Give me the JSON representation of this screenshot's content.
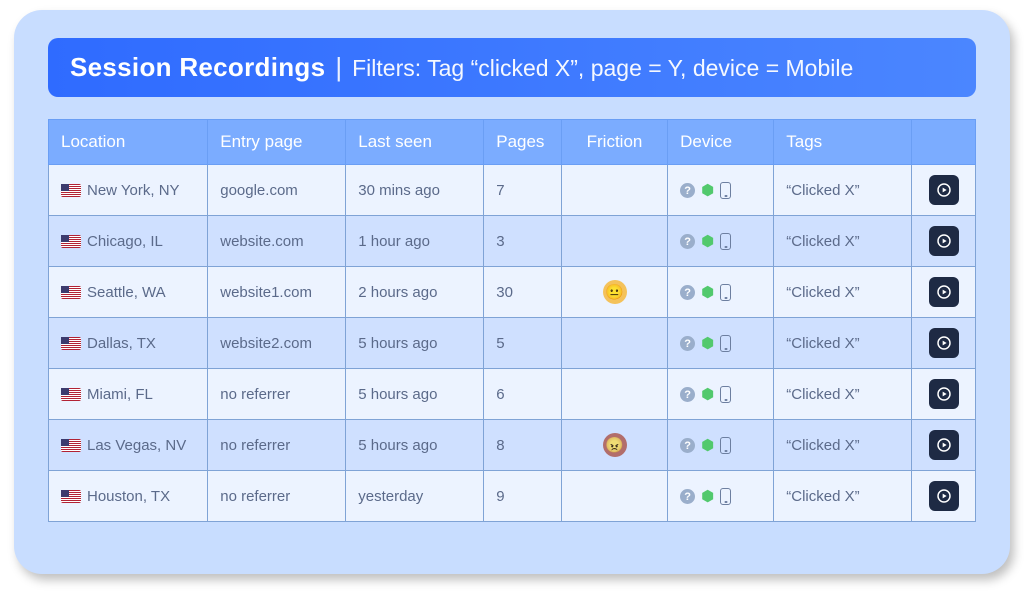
{
  "header": {
    "title": "Session Recordings",
    "separator": "|",
    "filters": "Filters: Tag “clicked X”, page = Y, device = Mobile"
  },
  "columns": {
    "location": "Location",
    "entry_page": "Entry page",
    "last_seen": "Last seen",
    "pages": "Pages",
    "friction": "Friction",
    "device": "Device",
    "tags": "Tags",
    "play": ""
  },
  "rows": [
    {
      "location": "New York, NY",
      "entry": "google.com",
      "last": "30 mins ago",
      "pages": "7",
      "friction": "",
      "tag": "“Clicked X”"
    },
    {
      "location": "Chicago, IL",
      "entry": "website.com",
      "last": "1 hour ago",
      "pages": "3",
      "friction": "",
      "tag": "“Clicked X”"
    },
    {
      "location": "Seattle, WA",
      "entry": "website1.com",
      "last": "2 hours ago",
      "pages": "30",
      "friction": "neutral",
      "tag": "“Clicked X”"
    },
    {
      "location": "Dallas, TX",
      "entry": "website2.com",
      "last": "5 hours ago",
      "pages": "5",
      "friction": "",
      "tag": "“Clicked X”"
    },
    {
      "location": "Miami, FL",
      "entry": "no referrer",
      "last": "5 hours ago",
      "pages": "6",
      "friction": "",
      "tag": "“Clicked X”"
    },
    {
      "location": "Las Vegas, NV",
      "entry": "no referrer",
      "last": "5 hours ago",
      "pages": "8",
      "friction": "bad",
      "tag": "“Clicked X”"
    },
    {
      "location": "Houston, TX",
      "entry": "no referrer",
      "last": "yesterday",
      "pages": "9",
      "friction": "",
      "tag": "“Clicked X”"
    }
  ]
}
